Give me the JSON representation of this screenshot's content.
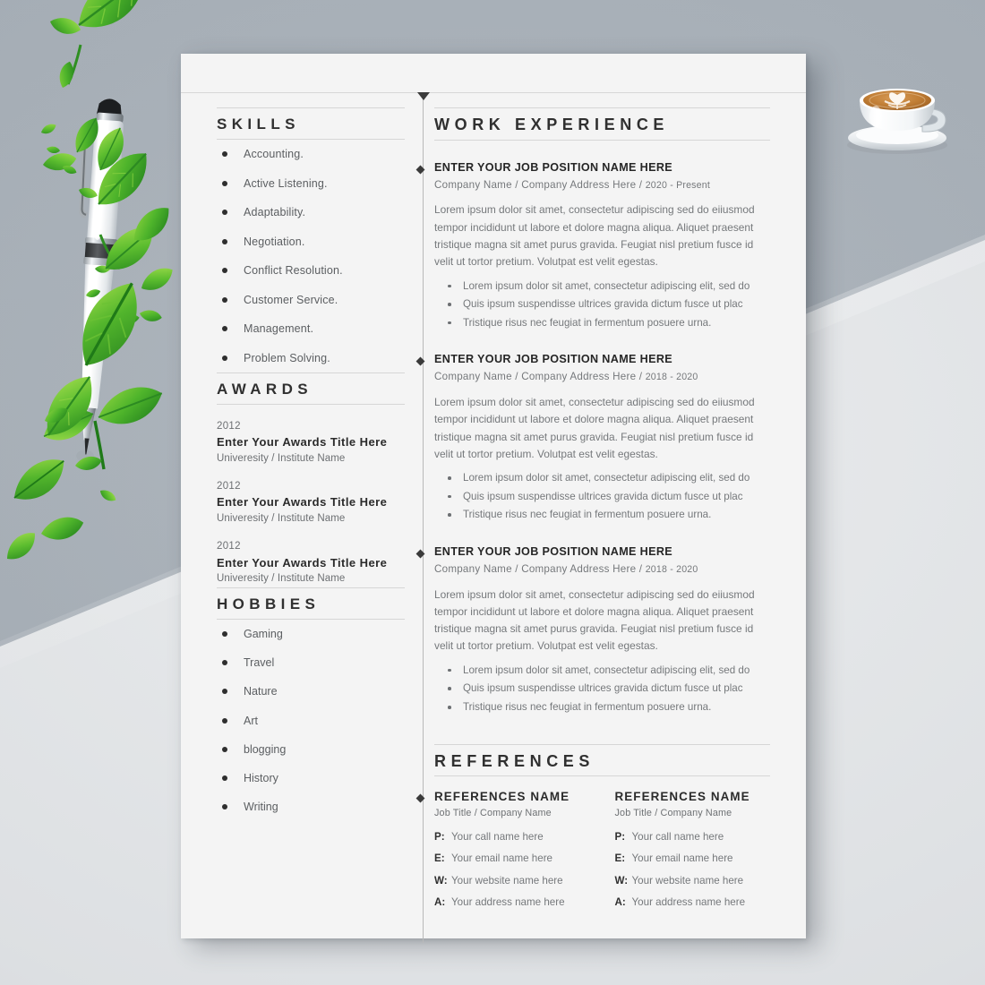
{
  "document": {
    "type": "resume-template-mockup",
    "page_background": "#f4f4f4",
    "scene_background_top": "#a9b1b9",
    "scene_background_bottom": "#e8eaec"
  },
  "left_column": {
    "skills": {
      "heading": "SKILLS",
      "items": [
        "Accounting.",
        "Active Listening.",
        "Adaptability.",
        "Negotiation.",
        "Conflict Resolution.",
        "Customer Service.",
        "Management.",
        "Problem Solving."
      ]
    },
    "awards": {
      "heading": "AWARDS",
      "items": [
        {
          "year": "2012",
          "title": "Enter Your Awards Title Here",
          "subtitle": "Univeresity / Institute Name"
        },
        {
          "year": "2012",
          "title": "Enter Your Awards Title Here",
          "subtitle": "Univeresity / Institute Name"
        },
        {
          "year": "2012",
          "title": "Enter Your Awards Title Here",
          "subtitle": "Univeresity / Institute Name"
        }
      ]
    },
    "hobbies": {
      "heading": "HOBBIES",
      "items": [
        "Gaming",
        "Travel",
        "Nature",
        "Art",
        "blogging",
        "History",
        "Writing"
      ]
    }
  },
  "right_column": {
    "work_experience": {
      "heading": "WORK EXPERIENCE",
      "jobs": [
        {
          "title": "ENTER YOUR JOB POSITION NAME HERE",
          "company": "Company Name",
          "address": "Company Address Here",
          "dates": "2020 - Present",
          "description": "Lorem ipsum dolor sit amet, consectetur adipiscing sed do eiiusmod tempor incididunt ut labore et dolore magna aliqua. Aliquet praesent tristique magna sit amet purus gravida. Feugiat nisl pretium fusce id velit ut tortor pretium. Volutpat est velit egestas.",
          "bullets": [
            "Lorem ipsum dolor sit amet, consectetur adipiscing elit, sed do",
            "Quis ipsum suspendisse ultrices gravida dictum fusce ut plac",
            "Tristique risus nec feugiat in fermentum posuere urna."
          ]
        },
        {
          "title": "ENTER YOUR JOB POSITION NAME HERE",
          "company": "Company Name",
          "address": "Company Address Here",
          "dates": "2018 - 2020",
          "description": "Lorem ipsum dolor sit amet, consectetur adipiscing sed do eiiusmod tempor incididunt ut labore et dolore magna aliqua. Aliquet praesent tristique magna sit amet purus gravida. Feugiat nisl pretium fusce id velit ut tortor pretium. Volutpat est velit egestas.",
          "bullets": [
            "Lorem ipsum dolor sit amet, consectetur adipiscing elit, sed do",
            "Quis ipsum suspendisse ultrices gravida dictum fusce ut plac",
            "Tristique risus nec feugiat in fermentum posuere urna."
          ]
        },
        {
          "title": "ENTER YOUR JOB POSITION NAME HERE",
          "company": "Company Name",
          "address": "Company Address Here",
          "dates": "2018 - 2020",
          "description": "Lorem ipsum dolor sit amet, consectetur adipiscing sed do eiiusmod tempor incididunt ut labore et dolore magna aliqua. Aliquet praesent tristique magna sit amet purus gravida. Feugiat nisl pretium fusce id velit ut tortor pretium. Volutpat est velit egestas.",
          "bullets": [
            "Lorem ipsum dolor sit amet, consectetur adipiscing elit, sed do",
            "Quis ipsum suspendisse ultrices gravida dictum fusce ut plac",
            "Tristique risus nec feugiat in fermentum posuere urna."
          ]
        }
      ],
      "separator": "/"
    },
    "references": {
      "heading": "REFERENCES",
      "entries": [
        {
          "name": "REFERENCES NAME",
          "role": "Job Title / Company Name",
          "phone_key": "P:",
          "phone_value": "Your  call name here",
          "email_key": "E:",
          "email_value": "Your email name here",
          "web_key": "W:",
          "web_value": "Your website name here",
          "address_key": "A:",
          "address_value": "Your address name here"
        },
        {
          "name": "REFERENCES NAME",
          "role": "Job Title / Company Name",
          "phone_key": "P:",
          "phone_value": "Your  call name here",
          "email_key": "E:",
          "email_value": "Your email name here",
          "web_key": "W:",
          "web_value": "Your website name here",
          "address_key": "A:",
          "address_value": "Your address name here"
        }
      ]
    }
  },
  "props": {
    "pen": "white-ballpoint-pen",
    "coffee": "coffee-cup-latte-art",
    "leaves": "green-leaves-decoration"
  }
}
